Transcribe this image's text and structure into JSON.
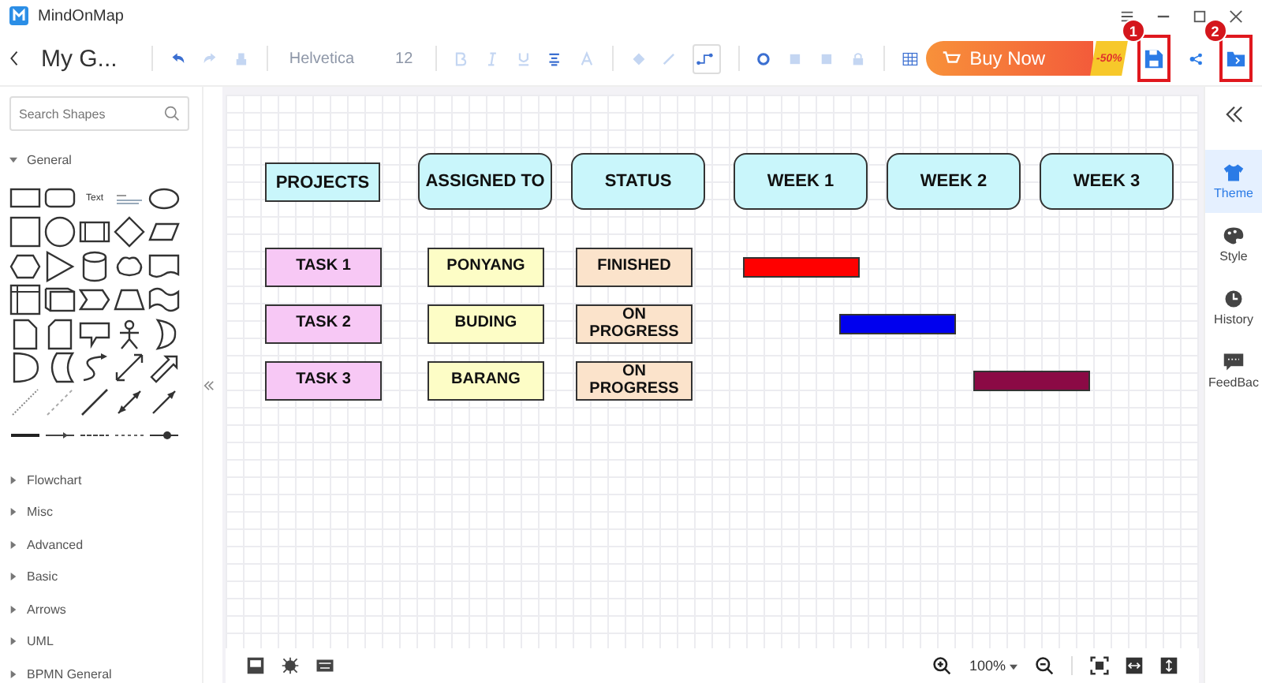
{
  "app": {
    "title": "MindOnMap"
  },
  "toolbar": {
    "document_title": "My G...",
    "font": "Helvetica",
    "font_size": "12",
    "buy_button": "Buy Now",
    "discount": "-50%",
    "callouts": [
      "1",
      "2"
    ]
  },
  "shapes_panel": {
    "search": {
      "placeholder": "Search Shapes"
    },
    "text_shape": "Text",
    "sections": [
      {
        "label": "General",
        "expanded": true
      },
      {
        "label": "Flowchart",
        "expanded": false
      },
      {
        "label": "Misc",
        "expanded": false
      },
      {
        "label": "Advanced",
        "expanded": false
      },
      {
        "label": "Basic",
        "expanded": false
      },
      {
        "label": "Arrows",
        "expanded": false
      },
      {
        "label": "UML",
        "expanded": false
      },
      {
        "label": "BPMN General",
        "expanded": false
      }
    ]
  },
  "canvas": {
    "headers": [
      {
        "label": "PROJECTS",
        "kind": "rect"
      },
      {
        "label": "ASSIGNED TO",
        "kind": "rounded"
      },
      {
        "label": "STATUS",
        "kind": "rounded"
      },
      {
        "label": "WEEK 1",
        "kind": "rounded"
      },
      {
        "label": "WEEK 2",
        "kind": "rounded"
      },
      {
        "label": "WEEK 3",
        "kind": "rounded"
      }
    ],
    "rows": [
      {
        "task": "TASK 1",
        "assignee": "PONYANG",
        "status": "FINISHED",
        "color": "#ff0000"
      },
      {
        "task": "TASK 2",
        "assignee": "BUDING",
        "status": "ON PROGRESS",
        "color": "#0000ee"
      },
      {
        "task": "TASK 3",
        "assignee": "BARANG",
        "status": "ON PROGRESS",
        "color": "#8b0a45"
      }
    ]
  },
  "bottom_bar": {
    "zoom": "100%"
  },
  "right_sidebar": {
    "items": [
      {
        "label": "Theme",
        "selected": true
      },
      {
        "label": "Style",
        "selected": false
      },
      {
        "label": "History",
        "selected": false
      },
      {
        "label": "FeedBac",
        "selected": false
      }
    ]
  }
}
